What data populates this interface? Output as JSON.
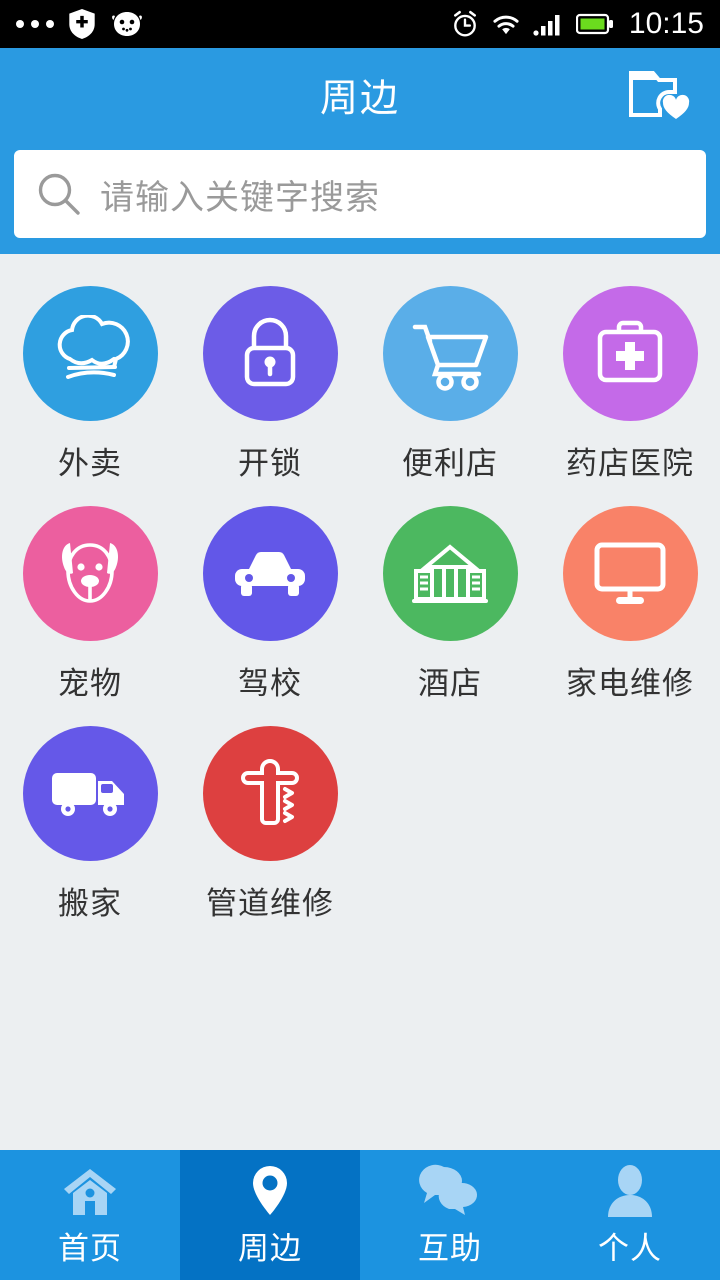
{
  "status_bar": {
    "time": "10:15",
    "left_icons": [
      "more-dots-icon",
      "shield-plus-icon",
      "android-robot-icon"
    ],
    "right_icons": [
      "alarm-clock-icon",
      "wifi-icon",
      "signal-bars-icon",
      "battery-icon"
    ],
    "battery_color": "#6bdc1e",
    "background": "#000000"
  },
  "header": {
    "title": "周边",
    "favorites_icon": "folder-heart-icon",
    "background": "#2a9ae1",
    "text_color": "#ffffff"
  },
  "search": {
    "placeholder": "请输入关键字搜索",
    "icon": "search-icon",
    "value": ""
  },
  "categories": [
    {
      "label": "外卖",
      "icon": "chef-hat-icon",
      "color": "#2f9fe0"
    },
    {
      "label": "开锁",
      "icon": "padlock-icon",
      "color": "#6c5ce7"
    },
    {
      "label": "便利店",
      "icon": "shopping-cart-icon",
      "color": "#5aaee8"
    },
    {
      "label": "药店医院",
      "icon": "first-aid-kit-icon",
      "color": "#c46ae8"
    },
    {
      "label": "宠物",
      "icon": "dog-face-icon",
      "color": "#ec5f9f"
    },
    {
      "label": "驾校",
      "icon": "car-icon",
      "color": "#6257e8"
    },
    {
      "label": "酒店",
      "icon": "hotel-building-icon",
      "color": "#4cb860"
    },
    {
      "label": "家电维修",
      "icon": "monitor-icon",
      "color": "#f98268"
    },
    {
      "label": "搬家",
      "icon": "moving-truck-icon",
      "color": "#6558e8"
    },
    {
      "label": "管道维修",
      "icon": "pipe-hydrant-icon",
      "color": "#dd4040"
    }
  ],
  "tabbar": {
    "background": "#1c93e0",
    "active_background": "#0472c4",
    "items": [
      {
        "label": "首页",
        "icon": "home-icon",
        "active": false
      },
      {
        "label": "周边",
        "icon": "location-pin-icon",
        "active": true
      },
      {
        "label": "互助",
        "icon": "chat-bubbles-icon",
        "active": false
      },
      {
        "label": "个人",
        "icon": "person-icon",
        "active": false
      }
    ]
  }
}
